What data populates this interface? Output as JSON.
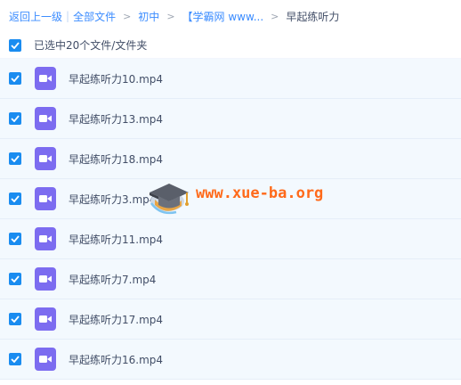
{
  "breadcrumb": {
    "back": "返回上一级",
    "all_files": "全部文件",
    "folder1": "初中",
    "folder2": "【学霸网 www...",
    "current": "早起练听力",
    "arrow": ">",
    "sep": "|"
  },
  "selection": {
    "label": "已选中20个文件/文件夹",
    "checked": true
  },
  "files": [
    {
      "name": "早起练听力10.mp4",
      "checked": true
    },
    {
      "name": "早起练听力13.mp4",
      "checked": true
    },
    {
      "name": "早起练听力18.mp4",
      "checked": true
    },
    {
      "name": "早起练听力3.mp4",
      "checked": true
    },
    {
      "name": "早起练听力11.mp4",
      "checked": true
    },
    {
      "name": "早起练听力7.mp4",
      "checked": true
    },
    {
      "name": "早起练听力17.mp4",
      "checked": true
    },
    {
      "name": "早起练听力16.mp4",
      "checked": true
    }
  ],
  "watermark": {
    "text": "www.xue-ba.org",
    "icon": "graduation-cap-icon"
  },
  "colors": {
    "accent": "#1a8cf0",
    "link": "#3b8cff",
    "video_icon": "#7c6cf0",
    "row_bg": "#f3f9fe",
    "watermark": "#ff6a1a"
  }
}
